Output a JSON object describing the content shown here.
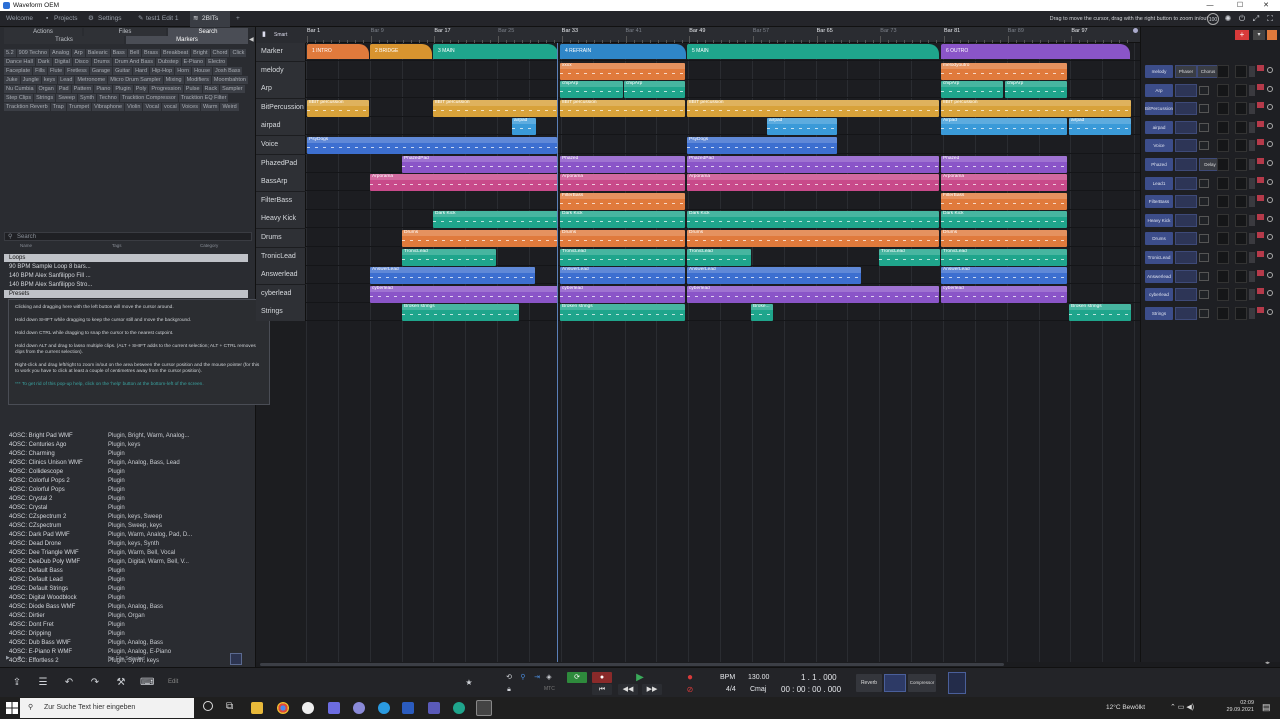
{
  "window": {
    "title": "Waveform OEM",
    "controls": [
      "—",
      "☐",
      "✕"
    ]
  },
  "tabs": [
    {
      "label": "Welcome"
    },
    {
      "label": "Projects"
    },
    {
      "label": "Settings"
    },
    {
      "label": "test1 Edit 1"
    },
    {
      "label": "2BITs"
    },
    {
      "label": "+"
    }
  ],
  "toolbar_hint": "Drag to move the cursor, drag with the right button to zoom in/out",
  "zoom_badge": "100",
  "browser": {
    "tabs_row1": [
      "Actions",
      "Files",
      "Search"
    ],
    "tabs_row2": [
      "Tracks",
      "Markers"
    ],
    "tags": [
      "5.2",
      "909 Techno",
      "Analog",
      "Arp",
      "Balearic",
      "Bass",
      "Bell",
      "Brass",
      "Breakbeat",
      "Bright",
      "Chord",
      "Click",
      "Dance Hall",
      "Dark",
      "Digital",
      "Disco",
      "Drums",
      "Drum And Bass",
      "Dubstep",
      "E-Piano",
      "Electro",
      "Faceplate",
      "Fills",
      "Flute",
      "Fretless",
      "Garage",
      "Guitar",
      "Hard",
      "Hip-Hop",
      "Horn",
      "House",
      "Josh Bass",
      "Juke",
      "Jungle",
      "keys",
      "Lead",
      "Metronome",
      "Micro Drum Sampler",
      "Mixing",
      "Modifiers",
      "Moombahton",
      "Nu Cumbia",
      "Organ",
      "Pad",
      "Pattern",
      "Piano",
      "Plugin",
      "Poly",
      "Progression",
      "Pulse",
      "Rack",
      "Sampler",
      "Step Clips",
      "Strings",
      "Sweep",
      "Synth",
      "Techno",
      "Tracktion Compressor",
      "Tracktion EQ Filter",
      "Tracktion Reverb",
      "Trap",
      "Trumpet",
      "Vibraphone",
      "Violin",
      "Vocal",
      "vocal",
      "Voices",
      "Warm",
      "Weird"
    ],
    "search_placeholder": "Search",
    "col_name": "Name",
    "col_tags": "Tags",
    "col_category": "Category",
    "groups": {
      "loops": "Loops",
      "presets": "Presets"
    },
    "loops": [
      "90 BPM Sample Loop 8 bars...",
      "140 BPM Alex Sanfilippo Fill ...",
      "140 BPM Alex Sanfilippo Stro..."
    ],
    "presets": [
      {
        "name": "4OSC: Bright Pad WMF",
        "tags": "Plugin, Bright, Warm, Analog..."
      },
      {
        "name": "4OSC: Centuries Ago",
        "tags": "Plugin, keys"
      },
      {
        "name": "4OSC: Charming",
        "tags": "Plugin"
      },
      {
        "name": "4OSC: Clinics Unison WMF",
        "tags": "Plugin, Analog, Bass, Lead"
      },
      {
        "name": "4OSC: Collidescope",
        "tags": "Plugin"
      },
      {
        "name": "4OSC: Colorful Pops 2",
        "tags": "Plugin"
      },
      {
        "name": "4OSC: Colorful Pops",
        "tags": "Plugin"
      },
      {
        "name": "4OSC: Crystal 2",
        "tags": "Plugin"
      },
      {
        "name": "4OSC: Crystal",
        "tags": "Plugin"
      },
      {
        "name": "4OSC: CZspectrum 2",
        "tags": "Plugin, keys, Sweep"
      },
      {
        "name": "4OSC: CZspectrum",
        "tags": "Plugin, Sweep, keys"
      },
      {
        "name": "4OSC: Dark Pad WMF",
        "tags": "Plugin, Warm, Analog, Pad, D..."
      },
      {
        "name": "4OSC: Dead Drone",
        "tags": "Plugin, keys, Synth"
      },
      {
        "name": "4OSC: Dee Triangle WMF",
        "tags": "Plugin, Warm, Bell, Vocal"
      },
      {
        "name": "4OSC: DeeDub Poly WMF",
        "tags": "Plugin, Digital, Warm, Bell, V..."
      },
      {
        "name": "4OSC: Default Bass",
        "tags": "Plugin"
      },
      {
        "name": "4OSC: Default Lead",
        "tags": "Plugin"
      },
      {
        "name": "4OSC: Default Strings",
        "tags": "Plugin"
      },
      {
        "name": "4OSC: Digital Woodblock",
        "tags": "Plugin"
      },
      {
        "name": "4OSC: Diode Bass WMF",
        "tags": "Plugin, Analog, Bass"
      },
      {
        "name": "4OSC: Dirtier",
        "tags": "Plugin, Organ"
      },
      {
        "name": "4OSC: Dont Fret",
        "tags": "Plugin"
      },
      {
        "name": "4OSC: Dripping",
        "tags": "Plugin"
      },
      {
        "name": "4OSC: Dub Bass WMF",
        "tags": "Plugin, Analog, Bass"
      },
      {
        "name": "4OSC: E-Piano R WMF",
        "tags": "Plugin, Analog, E-Piano"
      },
      {
        "name": "4OSC: Effortless 2",
        "tags": "Plugin, Synth, keys"
      }
    ],
    "footer_status": "No File Selected"
  },
  "tooltip": {
    "lines": [
      "Clicking and dragging here with the left button will move the cursor around.",
      "Hold down SHIFT while dragging to keep the cursor still and move the background.",
      "Hold down CTRL while dragging to snap the cursor to the nearest cutpoint.",
      "Hold down ALT and drag to lasso multiple clips. (ALT + SHIFT adds to the current selection; ALT + CTRL removes clips from the current selection).",
      "Right-click and drag left/right to zoom in/out on the area between the cursor position and the mouse pointer (for this to work you have to click at least a couple of centimetres away from the cursor position)."
    ],
    "footer": "*** To get rid of this pop-up help, click on the 'help' button at the bottom-left of the screen."
  },
  "arrangement": {
    "smart_label": "Smart",
    "bars": [
      {
        "label": "Bar 1",
        "major": true
      },
      {
        "label": "Bar 9"
      },
      {
        "label": "Bar 17",
        "major": true
      },
      {
        "label": "Bar 25"
      },
      {
        "label": "Bar 33",
        "major": true
      },
      {
        "label": "Bar 41"
      },
      {
        "label": "Bar 49",
        "major": true
      },
      {
        "label": "Bar 57"
      },
      {
        "label": "Bar 65",
        "major": true
      },
      {
        "label": "Bar 73"
      },
      {
        "label": "Bar 81",
        "major": true
      },
      {
        "label": "Bar 89"
      },
      {
        "label": "Bar 97",
        "major": true
      }
    ],
    "markers": [
      {
        "label": "1 INTRO",
        "color": "#e07a3c"
      },
      {
        "label": "2 BRIDGE",
        "color": "#d8942f"
      },
      {
        "label": "3 MAIN",
        "color": "#1fa58c"
      },
      {
        "label": "4 REFRAIN",
        "color": "#2f86c8"
      },
      {
        "label": "5 MAIN",
        "color": "#1fa58c"
      },
      {
        "label": "6 OUTRO",
        "color": "#8a55c8"
      }
    ],
    "tracks": [
      {
        "name": "Marker"
      },
      {
        "name": "melody",
        "clips": [
          {
            "label": "xxxx",
            "color": "#e07a3c"
          },
          {
            "label": "melodyoutro",
            "color": "#e07a3c"
          }
        ]
      },
      {
        "name": "Arp",
        "clips": [
          {
            "label": "chipArp",
            "color": "#1fa58c"
          },
          {
            "label": "chipArp",
            "color": "#1fa58c"
          },
          {
            "label": "chipArp",
            "color": "#1fa58c"
          },
          {
            "label": "chipArp",
            "color": "#1fa58c"
          }
        ]
      },
      {
        "name": "BitPercussion",
        "clips": [
          {
            "label": "8BIT percussion",
            "color": "#d8a23a"
          },
          {
            "label": "8BIT percussion",
            "color": "#d8a23a"
          },
          {
            "label": "8BIT percussion",
            "color": "#d8a23a"
          },
          {
            "label": "8BIT percussion",
            "color": "#d8a23a"
          },
          {
            "label": "8BIT percussion",
            "color": "#d8a23a"
          }
        ]
      },
      {
        "name": "airpad",
        "clips": [
          {
            "label": "airpad",
            "color": "#3a9ad8"
          },
          {
            "label": "airpad",
            "color": "#3a9ad8"
          },
          {
            "label": "Airpad",
            "color": "#3a9ad8"
          },
          {
            "label": "airpad",
            "color": "#3a9ad8"
          }
        ]
      },
      {
        "name": "Voice",
        "clips": [
          {
            "label": "PsyDogs",
            "color": "#3d6fd0"
          },
          {
            "label": "PsyDogs",
            "color": "#3d6fd0"
          }
        ]
      },
      {
        "name": "PhazedPad",
        "clips": [
          {
            "label": "PhazedPad",
            "color": "#8a55c8"
          },
          {
            "label": "Phazed",
            "color": "#8a55c8"
          },
          {
            "label": "PhazedPad",
            "color": "#8a55c8"
          },
          {
            "label": "Phazed",
            "color": "#8a55c8"
          }
        ]
      },
      {
        "name": "BassArp",
        "clips": [
          {
            "label": "Arporama",
            "color": "#c84a8a"
          },
          {
            "label": "Arporama",
            "color": "#c84a8a"
          },
          {
            "label": "Arporama",
            "color": "#c84a8a"
          },
          {
            "label": "Arporama",
            "color": "#c84a8a"
          }
        ]
      },
      {
        "name": "FilterBass",
        "clips": [
          {
            "label": "FilterBass",
            "color": "#e07a3c"
          },
          {
            "label": "FilterBass",
            "color": "#e07a3c"
          }
        ]
      },
      {
        "name": "Heavy Kick",
        "clips": [
          {
            "label": "Dark Kick",
            "color": "#1fa58c"
          },
          {
            "label": "Dark Kick",
            "color": "#1fa58c"
          },
          {
            "label": "Dark Kick",
            "color": "#1fa58c"
          },
          {
            "label": "Dark Kick",
            "color": "#1fa58c"
          }
        ]
      },
      {
        "name": "Drums",
        "clips": [
          {
            "label": "Drums",
            "color": "#e07a3c"
          },
          {
            "label": "Drums",
            "color": "#e07a3c"
          },
          {
            "label": "Drums",
            "color": "#e07a3c"
          },
          {
            "label": "Drums",
            "color": "#e07a3c"
          }
        ]
      },
      {
        "name": "TronicLead",
        "clips": [
          {
            "label": "TronicLead",
            "color": "#1fa58c"
          },
          {
            "label": "TronicLead",
            "color": "#1fa58c"
          },
          {
            "label": "TronicLead",
            "color": "#1fa58c"
          },
          {
            "label": "TronicLead",
            "color": "#1fa58c"
          },
          {
            "label": "TronicLead",
            "color": "#1fa58c"
          }
        ]
      },
      {
        "name": "Answerlead",
        "clips": [
          {
            "label": "AnswerLead",
            "color": "#3d6fd0"
          },
          {
            "label": "AnswerLead",
            "color": "#3d6fd0"
          },
          {
            "label": "AnswerLead",
            "color": "#3d6fd0"
          },
          {
            "label": "AnswerLead",
            "color": "#3d6fd0"
          }
        ]
      },
      {
        "name": "cyberlead",
        "clips": [
          {
            "label": "cyberlead",
            "color": "#8a55c8"
          },
          {
            "label": "cyberlead",
            "color": "#8a55c8"
          },
          {
            "label": "cyberlead",
            "color": "#8a55c8"
          },
          {
            "label": "cyberlead",
            "color": "#8a55c8"
          }
        ]
      },
      {
        "name": "Strings",
        "clips": [
          {
            "label": "Broken strings",
            "color": "#1fa58c"
          },
          {
            "label": "Broken strings",
            "color": "#1fa58c"
          },
          {
            "label": "Broke...",
            "color": "#1fa58c"
          },
          {
            "label": "Broken strings",
            "color": "#1fa58c"
          }
        ]
      }
    ]
  },
  "mixer": {
    "channels": [
      "melody",
      "Arp",
      "BitPercussion",
      "airpad",
      "Voice",
      "Phazed",
      "Lead1",
      "FilterBass",
      "Heavy Kick",
      "Drums",
      "TronicLead",
      "Answerlead",
      "cyberlead",
      "Strings"
    ],
    "melody_plugins": [
      "Phaser",
      "Chorus"
    ],
    "phazed_plugin": "Delay"
  },
  "transport": {
    "edit_label": "Edit",
    "bpm_label": "BPM",
    "bpm": "130.00",
    "timesig": "4/4",
    "key": "Cmaj",
    "position": "1 . 1 . 000",
    "time": "00 : 00 : 00 . 000",
    "mtc": "MTC",
    "fx1": "Reverb",
    "fx2": "Compressor"
  },
  "taskbar": {
    "search_placeholder": "Zur Suche Text hier eingeben",
    "weather": "12°C Bewölkt",
    "time": "02:09",
    "date": "29.09.2021"
  }
}
